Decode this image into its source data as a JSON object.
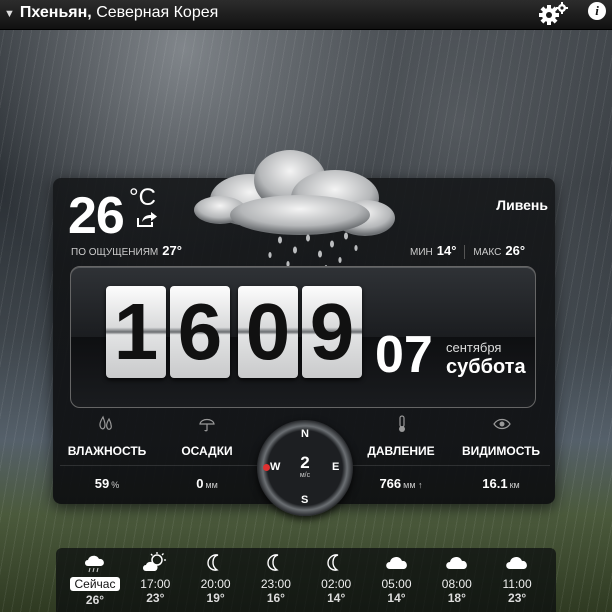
{
  "header": {
    "city": "Пхеньян,",
    "country": "Северная Корея"
  },
  "current": {
    "temperature": "26",
    "unit": "°C",
    "condition": "Ливень",
    "feels_like_label": "ПО ОЩУЩЕНИЯМ",
    "feels_like_value": "27°",
    "min_label": "МИН",
    "min_value": "14°",
    "max_label": "МАКС",
    "max_value": "26°"
  },
  "clock": {
    "digits": [
      "1",
      "6",
      "0",
      "9"
    ],
    "day": "07",
    "month": "сентября",
    "weekday": "суббота"
  },
  "stats": {
    "humidity_label": "ВЛАЖНОСТЬ",
    "humidity_value": "59",
    "humidity_unit": "%",
    "precip_label": "ОСАДКИ",
    "precip_value": "0",
    "precip_unit": "мм",
    "pressure_label": "ДАВЛЕНИЕ",
    "pressure_value": "766",
    "pressure_unit": "мм ↑",
    "visibility_label": "ВИДИМОСТЬ",
    "visibility_value": "16.1",
    "visibility_unit": "км"
  },
  "wind": {
    "speed": "2",
    "unit": "м/с",
    "n": "N",
    "e": "E",
    "s": "S",
    "w": "W"
  },
  "forecast": [
    {
      "time": "Сейчас",
      "temp": "26°",
      "icon": "cloud-rain-icon"
    },
    {
      "time": "17:00",
      "temp": "23°",
      "icon": "sun-cloud-icon"
    },
    {
      "time": "20:00",
      "temp": "19°",
      "icon": "moon-icon"
    },
    {
      "time": "23:00",
      "temp": "16°",
      "icon": "moon-icon"
    },
    {
      "time": "02:00",
      "temp": "14°",
      "icon": "moon-icon"
    },
    {
      "time": "05:00",
      "temp": "14°",
      "icon": "cloud-icon"
    },
    {
      "time": "08:00",
      "temp": "18°",
      "icon": "cloud-icon"
    },
    {
      "time": "11:00",
      "temp": "23°",
      "icon": "cloud-icon"
    }
  ]
}
